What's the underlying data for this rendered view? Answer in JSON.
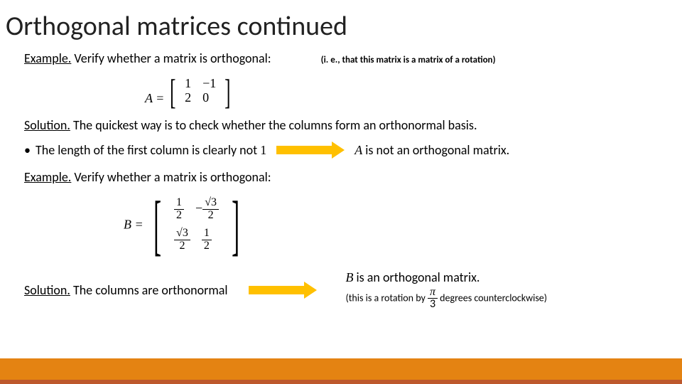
{
  "title": "Orthogonal matrices continued",
  "ex1": {
    "label": "Example.",
    "text": " Verify whether a matrix is orthogonal:",
    "paren": "(i. e., that this matrix is a matrix of a rotation)"
  },
  "matA": {
    "lhs": "A =",
    "c": [
      [
        "1",
        "−1"
      ],
      [
        "2",
        "0"
      ]
    ]
  },
  "sol1": {
    "label": "Solution.",
    "text": " The quickest way is to check whether the columns form an orthonormal basis."
  },
  "line3": {
    "bullet": "•",
    "a": "The length of the first column is clearly not ",
    "val": "1",
    "b": " is not an orthogonal matrix.",
    "Avar": "A"
  },
  "ex2": {
    "label": "Example.",
    "text": " Verify whether a matrix is orthogonal:"
  },
  "matB": {
    "lhs": "B =",
    "c": [
      [
        {
          "type": "frac",
          "num": "1",
          "den": "2"
        },
        {
          "type": "neg-frac",
          "num": "√3",
          "den": "2"
        }
      ],
      [
        {
          "type": "frac",
          "num": "√3",
          "den": "2"
        },
        {
          "type": "frac",
          "num": "1",
          "den": "2"
        }
      ]
    ]
  },
  "sol2": {
    "label": "Solution.",
    "text": " The columns are orthonormal",
    "Bvar": "B",
    "conc": " is an orthogonal matrix.",
    "note_a": "(this is a rotation by ",
    "note_num": "π",
    "note_den": "3",
    "note_b": " degrees counterclockwise)"
  }
}
